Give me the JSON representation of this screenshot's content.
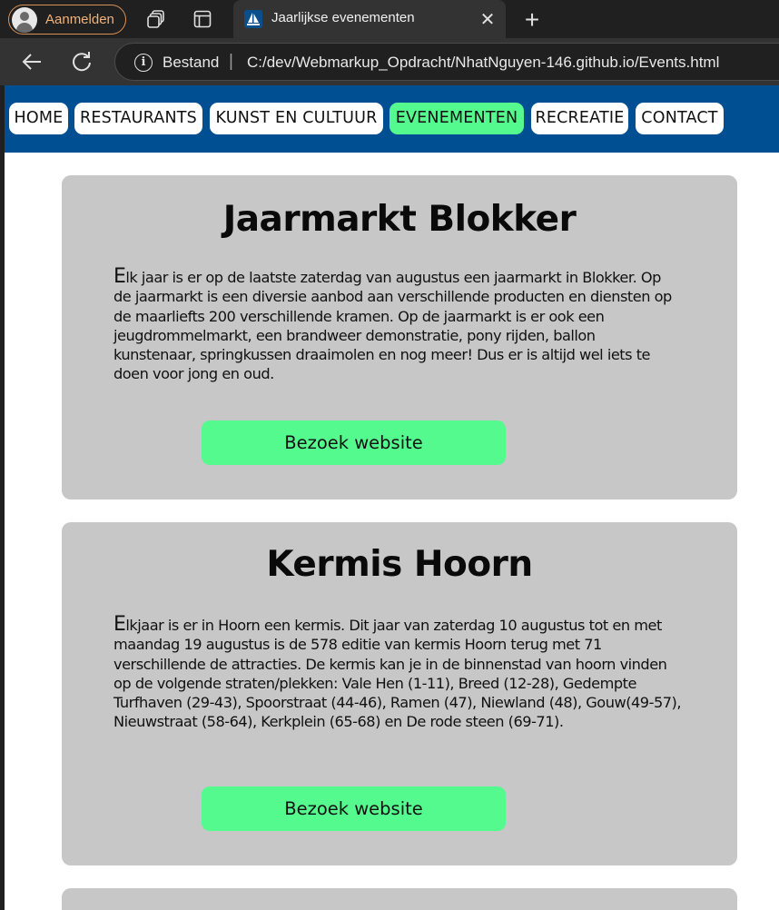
{
  "browser": {
    "profile_label": "Aanmelden",
    "tab_title": "Jaarlijkse evenementen",
    "tab_close": "✕",
    "new_tab": "+",
    "address": {
      "info_glyph": "i",
      "scheme_label": "Bestand",
      "separator": "|",
      "url": "C:/dev/Webmarkup_Opdracht/NhatNguyen-146.github.io/Events.html"
    }
  },
  "nav": {
    "items": [
      {
        "label": "HOME"
      },
      {
        "label": "RESTAURANTS"
      },
      {
        "label": "KUNST EN CULTUUR"
      },
      {
        "label": "EVENEMENTEN",
        "active": true
      },
      {
        "label": "RECREATIE"
      },
      {
        "label": "CONTACT"
      }
    ]
  },
  "events": [
    {
      "title": "Jaarmarkt Blokker",
      "first_letter": "E",
      "body": "lk jaar is er op de laatste zaterdag van augustus een jaarmarkt in Blokker. Op de jaarmarkt is een diversie aanbod aan verschillende producten en diensten op de maarliefts 200 verschillende kramen. Op de jaarmarkt is er ook een jeugdrommelmarkt, een brandweer demonstratie, pony rijden, ballon kunstenaar, springkussen draaimolen en nog meer! Dus er is altijd wel iets te doen voor jong en oud.",
      "button": "Bezoek website"
    },
    {
      "title": "Kermis Hoorn",
      "first_letter": "E",
      "body": "lkjaar is er in Hoorn een kermis. Dit jaar van zaterdag 10 augustus tot en met maandag 19 augustus is de 578 editie van kermis Hoorn terug met 71 verschillende de attracties. De kermis kan je in de binnenstad van hoorn vinden op de volgende straten/plekken: Vale Hen (1-11), Breed (12-28), Gedempte Turfhaven (29-43), Spoorstraat (44-46), Ramen (47), Niewland (48), Gouw(49-57), Nieuwstraat (58-64), Kerkplein (65-68) en De rode steen (69-71).",
      "button": "Bezoek website"
    }
  ],
  "colors": {
    "nav_bar": "#004f93",
    "active_accent": "#55fa8f",
    "card_bg": "#c7c7c7",
    "profile_accent": "#f0b27a"
  }
}
